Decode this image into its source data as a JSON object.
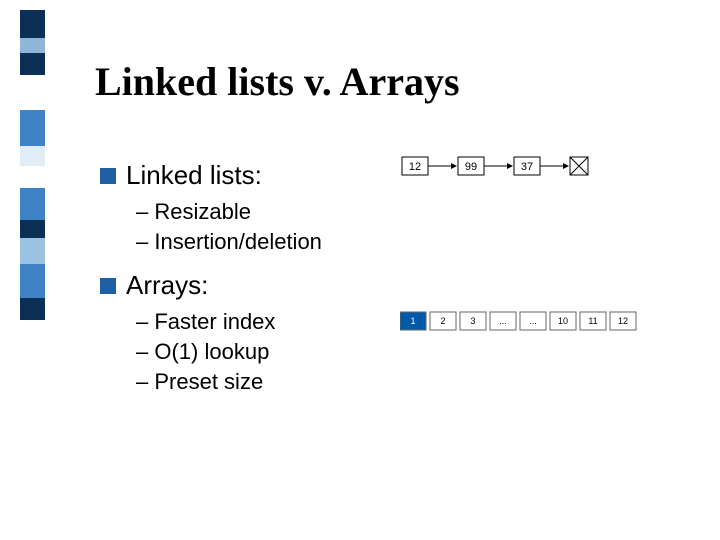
{
  "title": "Linked lists v. Arrays",
  "sections": [
    {
      "heading": "Linked lists:",
      "items": [
        "Resizable",
        "Insertion/deletion"
      ]
    },
    {
      "heading": "Arrays:",
      "items": [
        "Faster index",
        "O(1) lookup",
        "Preset size"
      ]
    }
  ],
  "linked_list_nodes": [
    "12",
    "99",
    "37"
  ],
  "array_cells": [
    "1",
    "2",
    "3",
    "...",
    "...",
    "10",
    "11",
    "12"
  ],
  "deco_colors": [
    "#0b2f55",
    "#8fb6d6",
    "#0b2f55",
    "#3f82c6",
    "#e0ecf6",
    "#3f82c6",
    "#0b2f55",
    "#9bc1e1",
    "#3f82c6",
    "#0b2f55"
  ]
}
